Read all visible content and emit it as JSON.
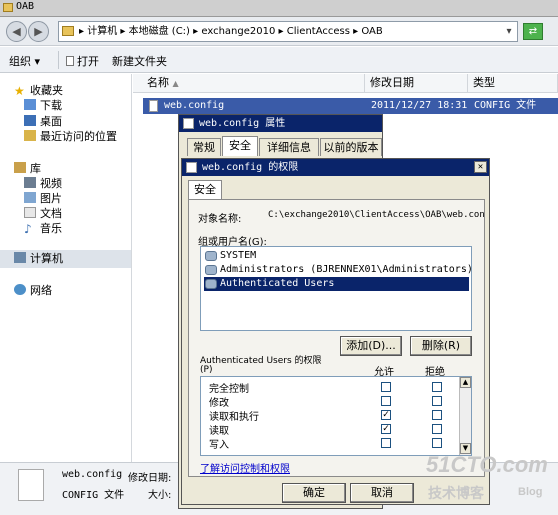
{
  "window": {
    "title": "OAB"
  },
  "address": {
    "segments": [
      "计算机",
      "本地磁盘 (C:)",
      "exchange2010",
      "ClientAccess",
      "OAB"
    ],
    "separator": "▸"
  },
  "toolbar": {
    "organize": "组织",
    "open": "打开",
    "new_folder": "新建文件夹"
  },
  "sidebar": {
    "favorites": "收藏夹",
    "fav_items": [
      "下载",
      "桌面",
      "最近访问的位置"
    ],
    "libraries": "库",
    "lib_items": [
      "视频",
      "图片",
      "文档",
      "音乐"
    ],
    "computer": "计算机",
    "network": "网络"
  },
  "columns": {
    "name": "名称",
    "date": "修改日期",
    "type": "类型"
  },
  "file": {
    "name": "web.config",
    "date": "2011/12/27 18:31",
    "type": "CONFIG 文件"
  },
  "details": {
    "name": "web.config",
    "date_label": "修改日期:",
    "type": "CONFIG 文件",
    "size_label": "大小:"
  },
  "props_dialog": {
    "title": "web.config 属性",
    "tabs": [
      "常规",
      "安全",
      "详细信息",
      "以前的版本"
    ]
  },
  "perm_dialog": {
    "title": "web.config 的权限",
    "tab": "安全",
    "object_label": "对象名称:",
    "object_path": "C:\\exchange2010\\ClientAccess\\OAB\\web.con",
    "group_label": "组或用户名(G):",
    "users": [
      "SYSTEM",
      "Administrators (BJRENNEX01\\Administrators)",
      "Authenticated Users"
    ],
    "add_button": "添加(D)...",
    "remove_button": "删除(R)",
    "perm_label_line1": "Authenticated Users 的权限",
    "perm_label_line2": "(P)",
    "allow_header": "允许",
    "deny_header": "拒绝",
    "permissions": [
      {
        "name": "完全控制",
        "allow": "",
        "deny": ""
      },
      {
        "name": "修改",
        "allow": "",
        "deny": ""
      },
      {
        "name": "读取和执行",
        "allow": "✓",
        "deny": ""
      },
      {
        "name": "读取",
        "allow": "✓",
        "deny": ""
      },
      {
        "name": "写入",
        "allow": "",
        "deny": ""
      }
    ],
    "link": "了解访问控制和权限",
    "ok_button": "确定",
    "cancel_button": "取消"
  },
  "watermark": {
    "site": "51CTO.com",
    "sub": "技术博客",
    "blog": "Blog"
  }
}
